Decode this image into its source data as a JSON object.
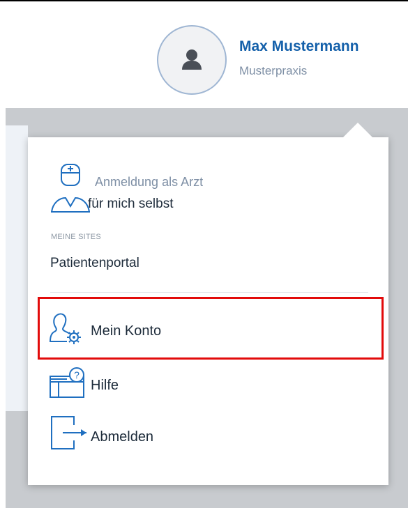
{
  "header": {
    "user_name": "Max Mustermann",
    "organization": "Musterpraxis"
  },
  "dropdown": {
    "role": {
      "line1": "Anmeldung als Arzt",
      "line2": "für mich selbst"
    },
    "sites_heading": "MEINE SITES",
    "sites": [
      "Patientenportal"
    ],
    "menu": {
      "account": "Mein Konto",
      "help": "Hilfe",
      "logout": "Abmelden"
    }
  },
  "colors": {
    "brand_blue": "#1460aa",
    "icon_blue": "#1f6fc0",
    "highlight_red": "#e20b0b",
    "overlay_gray": "#c8cbcf"
  },
  "icons": [
    "user-avatar-icon",
    "doctor-icon",
    "account-settings-icon",
    "help-window-icon",
    "logout-icon"
  ]
}
